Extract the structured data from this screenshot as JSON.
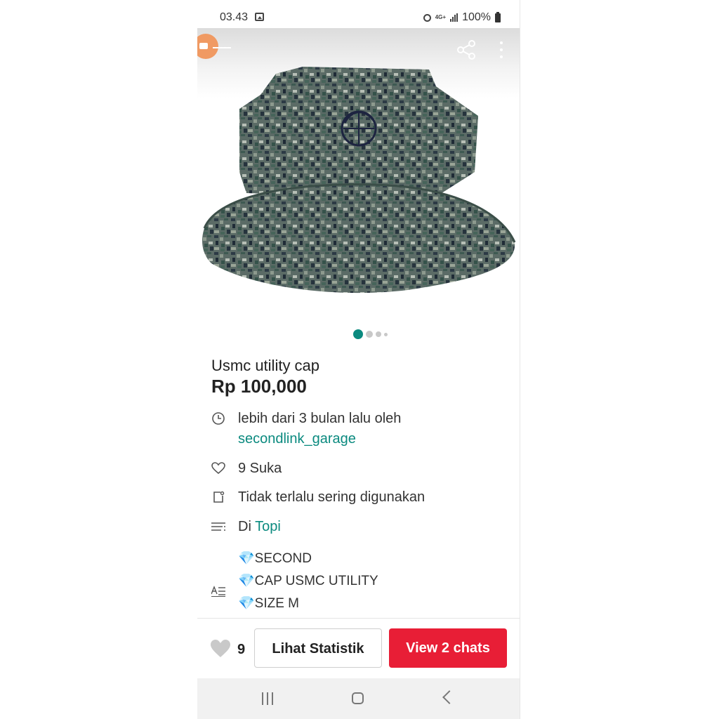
{
  "status_bar": {
    "time": "03.43",
    "network": "4G+",
    "battery": "100%"
  },
  "product": {
    "title": "Usmc utility cap",
    "price": "Rp 100,000",
    "image_index": 1,
    "image_count": 4
  },
  "details": {
    "posted_text": "lebih dari 3 bulan lalu oleh",
    "seller": "secondlink_garage",
    "likes_label": "9 Suka",
    "condition": "Tidak terlalu sering digunakan",
    "category_prefix": "Di",
    "category": "Topi",
    "description_lines": [
      "SECOND",
      "CAP USMC UTILITY",
      "SIZE M"
    ]
  },
  "bottom_bar": {
    "like_count": "9",
    "stats_button": "Lihat Statistik",
    "chat_button": "View 2 chats"
  },
  "colors": {
    "accent_teal": "#0b8a7f",
    "chat_red": "#e81e36"
  },
  "icons": [
    "back-icon",
    "share-icon",
    "more-icon",
    "clock-icon",
    "heart-icon",
    "condition-icon",
    "category-icon",
    "description-icon"
  ]
}
